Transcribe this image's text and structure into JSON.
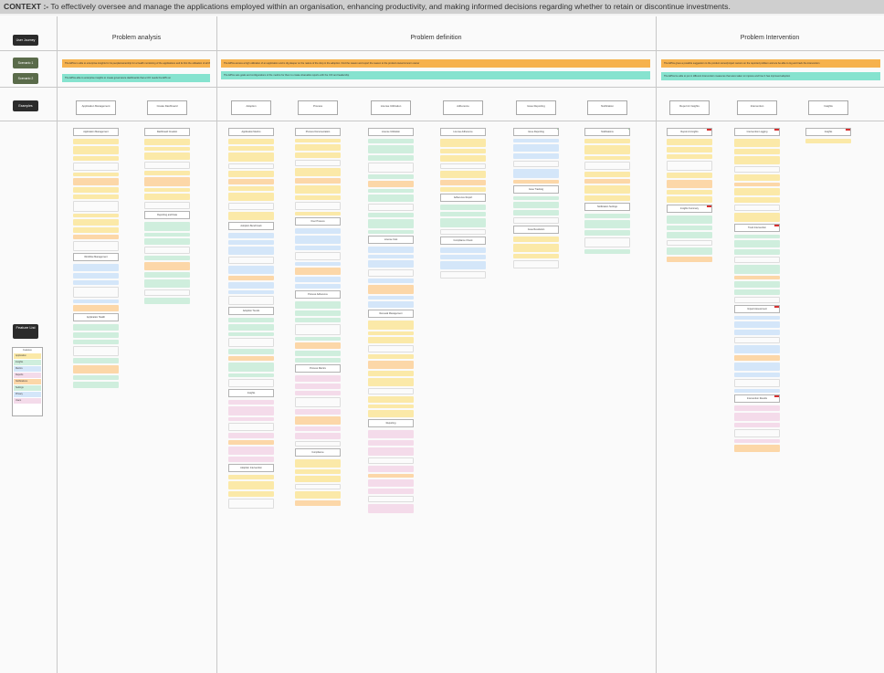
{
  "context": {
    "label": "CONTEXT :-",
    "text": "To effectively oversee and manage the applications employed within an organisation, enhancing productivity, and making informed decisions regarding whether to retain or discontinue investments."
  },
  "sections": [
    "Problem analysis",
    "Problem definition",
    "Problem Intervention"
  ],
  "side_tags": [
    {
      "label": "User Journey",
      "color": "#2b2b2b"
    },
    {
      "label": "Scenario 1",
      "color": "#5a6b4a"
    },
    {
      "label": "Scenario 2",
      "color": "#5a6b4a"
    },
    {
      "label": "Examples",
      "color": "#2b2b2b"
    },
    {
      "label": "Feature List",
      "color": "#2b2b2b"
    }
  ],
  "scenario_bands": {
    "analysis_orange": "The EPGs is able to enterprise insights for its people/ownership for a health monitoring of the applications and its first the utilisation of all the applications are as expected",
    "analysis_teal": "The EPGs able to enterprise insights to create governance dashboards that a CIO needs the EPG on",
    "definition_orange": "The EPGs access a high utilization of an application and is dig deeper on the nature of the drop in the adoption. Find the reason and report the reason to the product owner/concern owner",
    "definition_teal": "The EPGs sets goals and configurations of the metrics for them to create shareable reports with the CIO and leadership",
    "intervention_orange": "The EPGs gives a possible suggestion to the product owner/project owners on the reported problem and are be able to log and track the intervention",
    "intervention_teal": "The EPGs be able to put in different Intervention measures that were taken to impress and how it has improved adoption"
  },
  "column_heads": [
    "Application Management",
    "Create Dashboard",
    "Adoption",
    "Process",
    "License Utilization",
    "Adherence",
    "Issue Reporting",
    "Notification",
    "Report & Insights",
    "Intervention",
    "Insights"
  ],
  "legend": {
    "title": "Features",
    "items": [
      {
        "label": "Application",
        "color": "#fbe9a8"
      },
      {
        "label": "Insights",
        "color": "#cfeedd"
      },
      {
        "label": "Metrics",
        "color": "#d4e6f9"
      },
      {
        "label": "Reports",
        "color": "#f4dbea"
      },
      {
        "label": "Notifications",
        "color": "#fcd7a8"
      },
      {
        "label": "Settings",
        "color": "#cfeedd"
      },
      {
        "label": "Privacy",
        "color": "#d4e6f9"
      },
      {
        "label": "Users",
        "color": "#f4dbea"
      }
    ]
  },
  "columns": [
    {
      "cards": [
        [
          "Application Management",
          "y",
          14
        ],
        [
          "Workflow Management",
          "b",
          6
        ],
        [
          "Application Health",
          "g",
          8
        ]
      ]
    },
    {
      "cards": [
        [
          "Dashboard Creation",
          "y",
          9
        ],
        [
          "Reporting and Data",
          "g",
          10
        ]
      ]
    },
    {
      "cards": [
        [
          "Application Metrics",
          "y",
          10
        ],
        [
          "Adoption Benchmark",
          "b",
          9
        ],
        [
          "Adoption Trends",
          "g",
          9
        ],
        [
          "Insights",
          "p",
          8
        ],
        [
          "Adoption Intervention",
          "y",
          4
        ]
      ]
    },
    {
      "cards": [
        [
          "Process Documentation",
          "y",
          10
        ],
        [
          "Over Process",
          "b",
          8
        ],
        [
          "Process Adherence",
          "g",
          8
        ],
        [
          "Process Metrics",
          "p",
          9
        ],
        [
          "Compliance",
          "y",
          6
        ]
      ]
    },
    {
      "cards": [
        [
          "License Utilization",
          "g",
          12
        ],
        [
          "License Cost",
          "b",
          8
        ],
        [
          "Renewal Management",
          "y",
          12
        ],
        [
          "Reporting",
          "p",
          10
        ]
      ]
    },
    {
      "cards": [
        [
          "License Adherence",
          "y",
          7
        ],
        [
          "Adherence Report",
          "g",
          4
        ],
        [
          "Compliance Check",
          "b",
          4
        ]
      ]
    },
    {
      "cards": [
        [
          "Issue Reporting",
          "b",
          6
        ],
        [
          "Issue Tracking",
          "g",
          4
        ],
        [
          "Issue Resolution",
          "y",
          4
        ]
      ]
    },
    {
      "cards": [
        [
          "Notifications",
          "y",
          8
        ],
        [
          "Notification Settings",
          "g",
          5
        ]
      ]
    },
    {
      "cards": [
        [
          "Report & Insights",
          "y",
          8
        ],
        [
          "Insights Summary",
          "g",
          6
        ]
      ]
    },
    {
      "cards": [
        [
          "Intervention Logging",
          "y",
          10
        ],
        [
          "Track Intervention",
          "g",
          9
        ],
        [
          "Impact Assessment",
          "b",
          10
        ],
        [
          "Intervention Results",
          "p",
          6
        ]
      ]
    },
    {
      "cards": [
        [
          "Insights",
          "y",
          1
        ]
      ]
    }
  ]
}
